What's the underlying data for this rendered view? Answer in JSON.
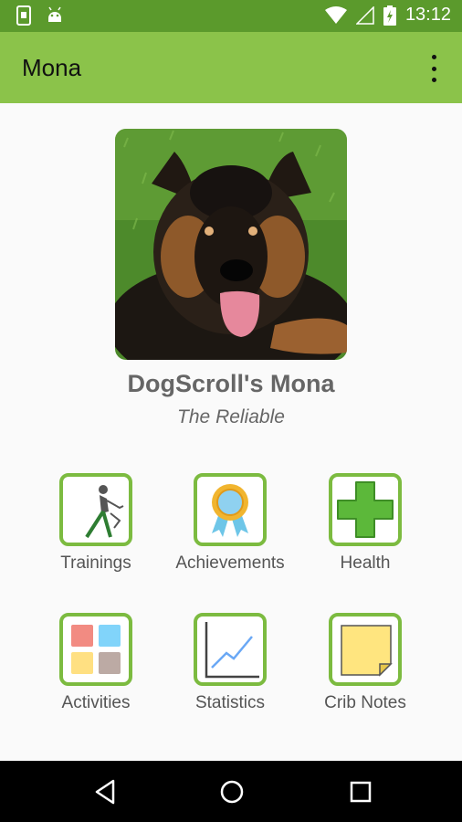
{
  "statusbar": {
    "time": "13:12"
  },
  "appbar": {
    "title": "Mona"
  },
  "dog": {
    "name": "DogScroll's Mona",
    "title": "The Reliable"
  },
  "menu": [
    {
      "label": "Trainings",
      "icon": "trainings-icon"
    },
    {
      "label": "Achievements",
      "icon": "achievements-icon"
    },
    {
      "label": "Health",
      "icon": "health-icon"
    },
    {
      "label": "Activities",
      "icon": "activities-icon"
    },
    {
      "label": "Statistics",
      "icon": "statistics-icon"
    },
    {
      "label": "Crib Notes",
      "icon": "crib-notes-icon"
    }
  ],
  "colors": {
    "accent": "#8bc34a",
    "statusbar": "#5b9a2c",
    "tile_border": "#7cbb40"
  }
}
